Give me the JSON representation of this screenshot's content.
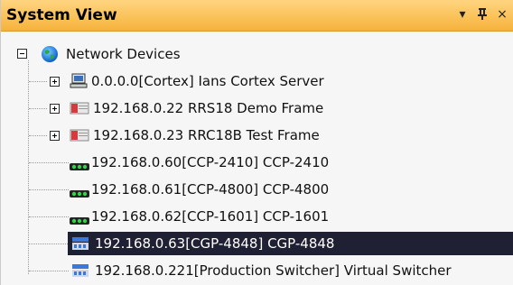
{
  "panel": {
    "title": "System View",
    "buttons": {
      "dropdown": "▾",
      "pin": "ᵦ",
      "close": "×"
    }
  },
  "tree": {
    "root": {
      "label": "Network Devices",
      "icon": "globe-icon"
    },
    "children": [
      {
        "label": "0.0.0.0[Cortex] Ians Cortex Server",
        "icon": "computer-icon",
        "expander": "plus"
      },
      {
        "label": "192.168.0.22 RRS18 Demo Frame",
        "icon": "frame-icon",
        "expander": "plus"
      },
      {
        "label": "192.168.0.23 RRC18B Test Frame",
        "icon": "frame-icon",
        "expander": "plus"
      },
      {
        "label": "192.168.0.60[CCP-2410] CCP-2410",
        "icon": "control-panel-icon"
      },
      {
        "label": "192.168.0.61[CCP-4800] CCP-4800",
        "icon": "control-panel-icon"
      },
      {
        "label": "192.168.0.62[CCP-1601] CCP-1601",
        "icon": "control-panel-icon"
      },
      {
        "label": "192.168.0.63[CGP-4848] CGP-4848",
        "icon": "switch-panel-icon",
        "selected": true
      },
      {
        "label": "192.168.0.221[Production Switcher] Virtual Switcher",
        "icon": "switch-panel-icon"
      }
    ]
  },
  "colors": {
    "title_bar": "#f6b23b",
    "selection": "#1f2033",
    "background": "#f6f6f6"
  }
}
